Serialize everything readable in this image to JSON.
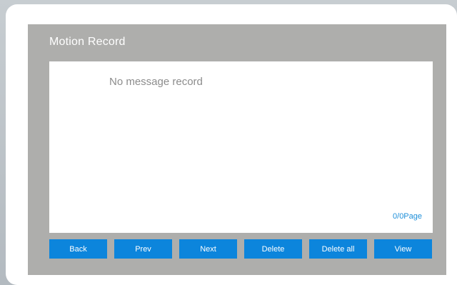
{
  "screen": {
    "title": "Motion Record",
    "empty_message": "No message record",
    "page_indicator": "0/0Page"
  },
  "buttons": {
    "back": "Back",
    "prev": "Prev",
    "next": "Next",
    "delete": "Delete",
    "delete_all": "Delete all",
    "view": "View"
  },
  "colors": {
    "screen_bg": "#aeaeac",
    "button_bg": "#0c85dc",
    "page_indicator": "#1e8fd9"
  }
}
